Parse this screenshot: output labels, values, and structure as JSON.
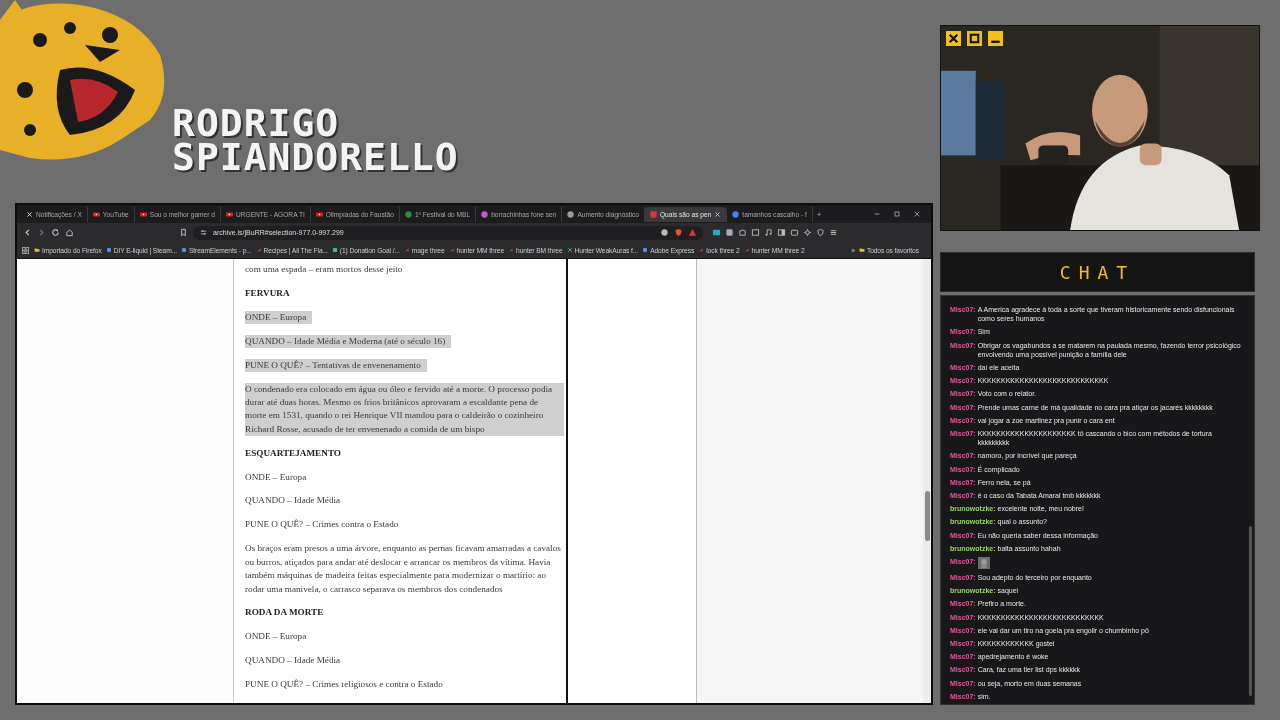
{
  "brand": {
    "lines": [
      "RODRIGO",
      "SPIANDORELLO"
    ]
  },
  "browser": {
    "tabs": [
      {
        "title": "Notificações / X",
        "kind": "x",
        "selected": false
      },
      {
        "title": "YouTube",
        "kind": "youtube",
        "selected": false
      },
      {
        "title": "Sou o melhor gamer d",
        "kind": "youtube",
        "selected": false
      },
      {
        "title": "URGENTE - AGORA TI",
        "kind": "youtube",
        "selected": false
      },
      {
        "title": "Olimpíadas do Faustão",
        "kind": "youtube",
        "selected": false
      },
      {
        "title": "1º Festival do MBL",
        "kind": "green",
        "selected": false
      },
      {
        "title": "borrachinhas fone sen",
        "kind": "multi",
        "selected": false
      },
      {
        "title": "Aumento diagnóstico",
        "kind": "grey",
        "selected": false
      },
      {
        "title": "Quais são as pen",
        "kind": "red",
        "selected": true
      },
      {
        "title": "tamanhos cascalho - f",
        "kind": "google",
        "selected": false
      }
    ],
    "new_tab": "+",
    "url": "archive.is/jBuRR#selection-977.0-997.299",
    "bookmarks": [
      {
        "label": "Importado do Firefox",
        "kind": "folder"
      },
      {
        "label": "DIY E-liquid | Steam...",
        "kind": "site"
      },
      {
        "label": "StreamElements - p...",
        "kind": "site"
      },
      {
        "label": "Recipes | All The Fla...",
        "kind": "bird"
      },
      {
        "label": "(1) Donation Goal /...",
        "kind": "green"
      },
      {
        "label": "mage three",
        "kind": "bird"
      },
      {
        "label": "hunter MM three",
        "kind": "bird"
      },
      {
        "label": "hunter BM three",
        "kind": "bird"
      },
      {
        "label": "Hunter WeakAuras f...",
        "kind": "x"
      },
      {
        "label": "Adobe Express",
        "kind": "site"
      },
      {
        "label": "lock three 2",
        "kind": "bird"
      },
      {
        "label": "hunter MM three 2",
        "kind": "bird"
      }
    ],
    "more_bookmarks": "»",
    "all_bookmarks": "Todos os favoritos",
    "article": [
      {
        "kind": "text",
        "text": "com uma espada – eram mortos desse jeito",
        "highlighted": false
      },
      {
        "kind": "heading",
        "text": "FERVURA",
        "highlighted": false
      },
      {
        "kind": "text",
        "text": "ONDE – Europa",
        "highlighted": true
      },
      {
        "kind": "text",
        "text": "QUANDO – Idade Média e Moderna (até o século 16)",
        "highlighted": true
      },
      {
        "kind": "text",
        "text": "PUNE O QUÊ? – Tentativas de envenenamento",
        "highlighted": true
      },
      {
        "kind": "text",
        "text": "O condenado era colocado em água ou óleo e fervido até a morte. O processo podia durar até duas horas. Mesmo os frios britânicos aprovaram a escaldante pena de morte em 1531, quando o rei Henrique VII mandou para o caldeirão o cozinheiro Richard Rosse, acusado de ter envenenado a comida de um bispo",
        "highlighted": true
      },
      {
        "kind": "heading",
        "text": "ESQUARTEJAMENTO",
        "highlighted": false
      },
      {
        "kind": "text",
        "text": "ONDE – Europa",
        "highlighted": false
      },
      {
        "kind": "text",
        "text": "QUANDO – Idade Média",
        "highlighted": false
      },
      {
        "kind": "text",
        "text": "PUNE O QUÊ? – Crimes contra o Estado",
        "highlighted": false
      },
      {
        "kind": "text",
        "text": "Os braços eram presos a uma árvore, enquanto as pernas ficavam amarradas a cavalos ou burros, atiçados para andar até deslocar e arrancar os membros da vítima. Havia também máquinas de madeira feitas especialmente para modernizar o martírio: ao rodar uma manivela, o carrasco separava os membros dos condenados",
        "highlighted": false
      },
      {
        "kind": "heading",
        "text": "RODA DA MORTE",
        "highlighted": false
      },
      {
        "kind": "text",
        "text": "ONDE – Europa",
        "highlighted": false
      },
      {
        "kind": "text",
        "text": "QUANDO – Idade Média",
        "highlighted": false
      },
      {
        "kind": "text",
        "text": "PUNE O QUÊ? – Crimes religiosos e contra o Estado",
        "highlighted": false
      }
    ]
  },
  "chat": {
    "title": "CHAT",
    "messages": [
      {
        "user": "Misc07:",
        "color": "#e05a9c",
        "kind": "text",
        "text": "A America agradece à toda a sorte que tiveram historicamente sendo disfuncionais como seres humanos"
      },
      {
        "user": "Misc07:",
        "color": "#e05a9c",
        "kind": "text",
        "text": "Sim"
      },
      {
        "user": "Misc07:",
        "color": "#e05a9c",
        "kind": "text",
        "text": "Obrigar os vagabundos a se matarem na paulada mesmo, fazendo terror psicológico envolvendo uma possível punição a família dele"
      },
      {
        "user": "Misc07:",
        "color": "#e05a9c",
        "kind": "text",
        "text": "daí ele aceita"
      },
      {
        "user": "Misc07:",
        "color": "#e05a9c",
        "kind": "text",
        "text": "KKKKKKKKKKKKKKKKKKKKKKKKKKKK"
      },
      {
        "user": "Misc07:",
        "color": "#e05a9c",
        "kind": "text",
        "text": "Voto com o relator."
      },
      {
        "user": "Misc07:",
        "color": "#e05a9c",
        "kind": "text",
        "text": "Prende umas carne de má qualidade no cara pra atiçar os jacarés kkkkkkkk"
      },
      {
        "user": "Misc07:",
        "color": "#e05a9c",
        "kind": "text",
        "text": "vai jogar a zoe martinez pra punir o cara ent"
      },
      {
        "user": "Misc07:",
        "color": "#e05a9c",
        "kind": "text",
        "text": "KKKKKKKKKKKKKKKKKKKKK tô cascando o bico com métodos de tortura kkkkkkkkk"
      },
      {
        "user": "Misc07:",
        "color": "#e05a9c",
        "kind": "text",
        "text": "namoro, por incrível que pareça"
      },
      {
        "user": "Misc07:",
        "color": "#e05a9c",
        "kind": "text",
        "text": "É complicado"
      },
      {
        "user": "Misc07:",
        "color": "#e05a9c",
        "kind": "text",
        "text": "Ferro nela, se pá"
      },
      {
        "user": "Misc07:",
        "color": "#e05a9c",
        "kind": "text",
        "text": "é o caso da Tabata Amaral tmb kkkkkkk"
      },
      {
        "user": "brunowotzke:",
        "color": "#9ed36a",
        "kind": "text",
        "text": "excelente noite, meu nobre!"
      },
      {
        "user": "brunowotzke:",
        "color": "#9ed36a",
        "kind": "text",
        "text": "qual o assunto?"
      },
      {
        "user": "Misc07:",
        "color": "#e05a9c",
        "kind": "text",
        "text": "Eu não queria saber dessa informação"
      },
      {
        "user": "brunowotzke:",
        "color": "#9ed36a",
        "kind": "text",
        "text": "balta assunto hahah"
      },
      {
        "user": "Misc07:",
        "color": "#e05a9c",
        "kind": "emote"
      },
      {
        "user": "Misc07:",
        "color": "#e05a9c",
        "kind": "text",
        "text": "Sou adepto do terceiro por enquanto"
      },
      {
        "user": "brunowotzke:",
        "color": "#9ed36a",
        "kind": "text",
        "text": "saquei"
      },
      {
        "user": "Misc07:",
        "color": "#e05a9c",
        "kind": "text",
        "text": "Prefiro a morte."
      },
      {
        "user": "Misc07:",
        "color": "#e05a9c",
        "kind": "text",
        "text": "KKKKKKKKKKKKKKKKKKKKKKKKKKK"
      },
      {
        "user": "Misc07:",
        "color": "#e05a9c",
        "kind": "text",
        "text": "ele vai dar um tiro na goela pra engolir o chumbinho pô"
      },
      {
        "user": "Misc07:",
        "color": "#e05a9c",
        "kind": "text",
        "text": "KKKKKKKKKKKK gostei"
      },
      {
        "user": "Misc07:",
        "color": "#e05a9c",
        "kind": "text",
        "text": "apedrejamento é woke"
      },
      {
        "user": "Misc07:",
        "color": "#e05a9c",
        "kind": "text",
        "text": "Cara, faz uma tier list dps kkkkkk"
      },
      {
        "user": "Misc07:",
        "color": "#e05a9c",
        "kind": "text",
        "text": "ou seja, morto em duas semanas"
      },
      {
        "user": "Misc07:",
        "color": "#e05a9c",
        "kind": "text",
        "text": "sim."
      }
    ]
  }
}
